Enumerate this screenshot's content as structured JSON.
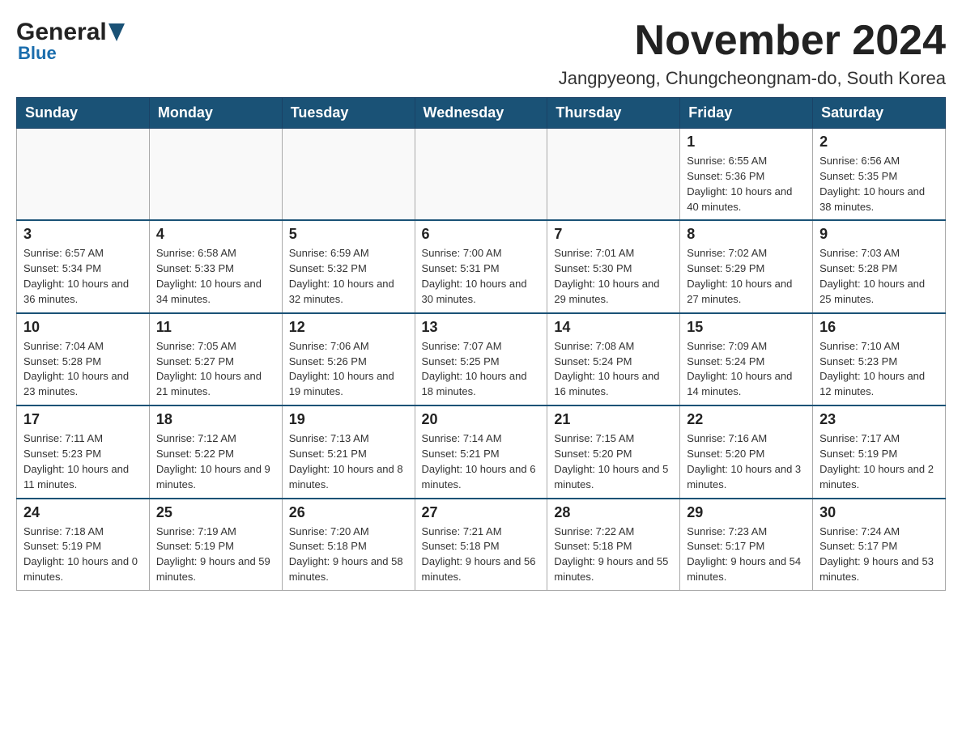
{
  "header": {
    "month_title": "November 2024",
    "location": "Jangpyeong, Chungcheongnam-do, South Korea",
    "logo_general": "General",
    "logo_blue": "Blue"
  },
  "days_of_week": [
    "Sunday",
    "Monday",
    "Tuesday",
    "Wednesday",
    "Thursday",
    "Friday",
    "Saturday"
  ],
  "weeks": [
    [
      {
        "day": "",
        "info": ""
      },
      {
        "day": "",
        "info": ""
      },
      {
        "day": "",
        "info": ""
      },
      {
        "day": "",
        "info": ""
      },
      {
        "day": "",
        "info": ""
      },
      {
        "day": "1",
        "info": "Sunrise: 6:55 AM\nSunset: 5:36 PM\nDaylight: 10 hours and 40 minutes."
      },
      {
        "day": "2",
        "info": "Sunrise: 6:56 AM\nSunset: 5:35 PM\nDaylight: 10 hours and 38 minutes."
      }
    ],
    [
      {
        "day": "3",
        "info": "Sunrise: 6:57 AM\nSunset: 5:34 PM\nDaylight: 10 hours and 36 minutes."
      },
      {
        "day": "4",
        "info": "Sunrise: 6:58 AM\nSunset: 5:33 PM\nDaylight: 10 hours and 34 minutes."
      },
      {
        "day": "5",
        "info": "Sunrise: 6:59 AM\nSunset: 5:32 PM\nDaylight: 10 hours and 32 minutes."
      },
      {
        "day": "6",
        "info": "Sunrise: 7:00 AM\nSunset: 5:31 PM\nDaylight: 10 hours and 30 minutes."
      },
      {
        "day": "7",
        "info": "Sunrise: 7:01 AM\nSunset: 5:30 PM\nDaylight: 10 hours and 29 minutes."
      },
      {
        "day": "8",
        "info": "Sunrise: 7:02 AM\nSunset: 5:29 PM\nDaylight: 10 hours and 27 minutes."
      },
      {
        "day": "9",
        "info": "Sunrise: 7:03 AM\nSunset: 5:28 PM\nDaylight: 10 hours and 25 minutes."
      }
    ],
    [
      {
        "day": "10",
        "info": "Sunrise: 7:04 AM\nSunset: 5:28 PM\nDaylight: 10 hours and 23 minutes."
      },
      {
        "day": "11",
        "info": "Sunrise: 7:05 AM\nSunset: 5:27 PM\nDaylight: 10 hours and 21 minutes."
      },
      {
        "day": "12",
        "info": "Sunrise: 7:06 AM\nSunset: 5:26 PM\nDaylight: 10 hours and 19 minutes."
      },
      {
        "day": "13",
        "info": "Sunrise: 7:07 AM\nSunset: 5:25 PM\nDaylight: 10 hours and 18 minutes."
      },
      {
        "day": "14",
        "info": "Sunrise: 7:08 AM\nSunset: 5:24 PM\nDaylight: 10 hours and 16 minutes."
      },
      {
        "day": "15",
        "info": "Sunrise: 7:09 AM\nSunset: 5:24 PM\nDaylight: 10 hours and 14 minutes."
      },
      {
        "day": "16",
        "info": "Sunrise: 7:10 AM\nSunset: 5:23 PM\nDaylight: 10 hours and 12 minutes."
      }
    ],
    [
      {
        "day": "17",
        "info": "Sunrise: 7:11 AM\nSunset: 5:23 PM\nDaylight: 10 hours and 11 minutes."
      },
      {
        "day": "18",
        "info": "Sunrise: 7:12 AM\nSunset: 5:22 PM\nDaylight: 10 hours and 9 minutes."
      },
      {
        "day": "19",
        "info": "Sunrise: 7:13 AM\nSunset: 5:21 PM\nDaylight: 10 hours and 8 minutes."
      },
      {
        "day": "20",
        "info": "Sunrise: 7:14 AM\nSunset: 5:21 PM\nDaylight: 10 hours and 6 minutes."
      },
      {
        "day": "21",
        "info": "Sunrise: 7:15 AM\nSunset: 5:20 PM\nDaylight: 10 hours and 5 minutes."
      },
      {
        "day": "22",
        "info": "Sunrise: 7:16 AM\nSunset: 5:20 PM\nDaylight: 10 hours and 3 minutes."
      },
      {
        "day": "23",
        "info": "Sunrise: 7:17 AM\nSunset: 5:19 PM\nDaylight: 10 hours and 2 minutes."
      }
    ],
    [
      {
        "day": "24",
        "info": "Sunrise: 7:18 AM\nSunset: 5:19 PM\nDaylight: 10 hours and 0 minutes."
      },
      {
        "day": "25",
        "info": "Sunrise: 7:19 AM\nSunset: 5:19 PM\nDaylight: 9 hours and 59 minutes."
      },
      {
        "day": "26",
        "info": "Sunrise: 7:20 AM\nSunset: 5:18 PM\nDaylight: 9 hours and 58 minutes."
      },
      {
        "day": "27",
        "info": "Sunrise: 7:21 AM\nSunset: 5:18 PM\nDaylight: 9 hours and 56 minutes."
      },
      {
        "day": "28",
        "info": "Sunrise: 7:22 AM\nSunset: 5:18 PM\nDaylight: 9 hours and 55 minutes."
      },
      {
        "day": "29",
        "info": "Sunrise: 7:23 AM\nSunset: 5:17 PM\nDaylight: 9 hours and 54 minutes."
      },
      {
        "day": "30",
        "info": "Sunrise: 7:24 AM\nSunset: 5:17 PM\nDaylight: 9 hours and 53 minutes."
      }
    ]
  ]
}
